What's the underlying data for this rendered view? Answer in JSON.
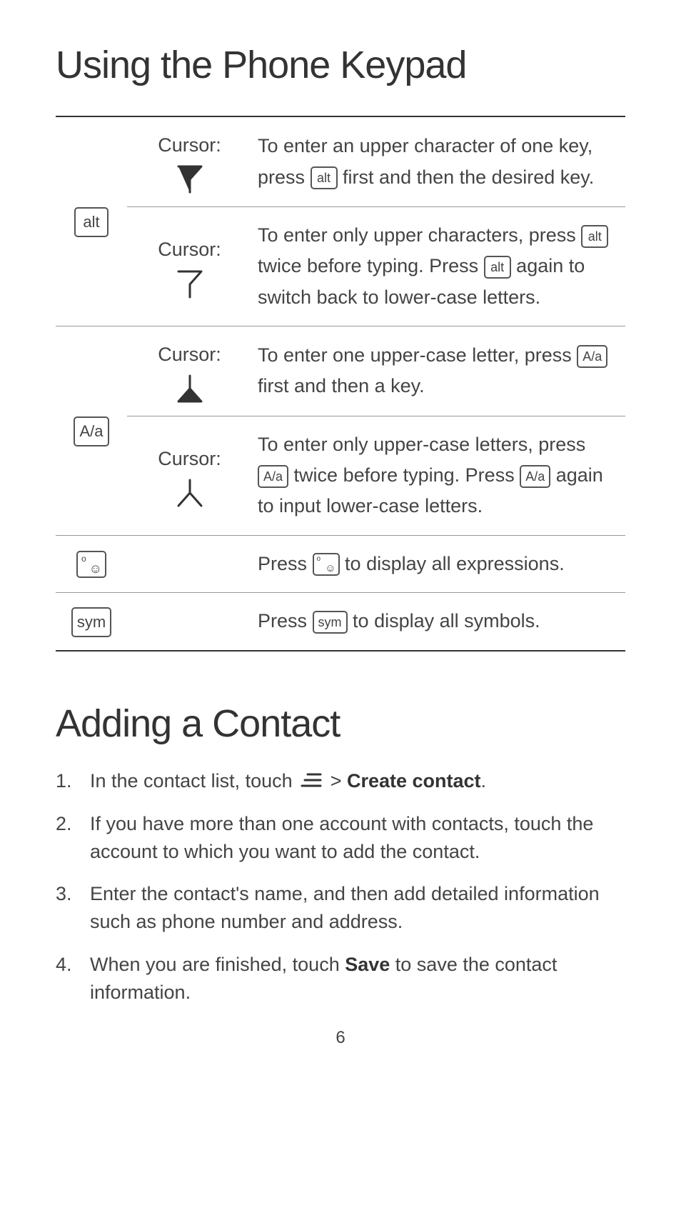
{
  "heading1": "Using the Phone Keypad",
  "heading2": "Adding a Contact",
  "keys": {
    "alt": "alt",
    "aa": "A/a",
    "sym": "sym",
    "emoji_sup": "o",
    "emoji_face": "☺"
  },
  "cursor_label": "Cursor:",
  "rows": {
    "alt_single": {
      "pre": "To enter an upper character of one key, press ",
      "post": " first and then the desired key."
    },
    "alt_double": {
      "pre": "To enter only upper characters, press ",
      "mid": " twice before typing. Press ",
      "post": " again to switch back to lower-case letters."
    },
    "aa_single": {
      "pre": "To enter one upper-case letter, press ",
      "post": " first and then a key."
    },
    "aa_double": {
      "pre": "To enter only upper-case letters, press ",
      "mid": " twice before typing. Press ",
      "post": " again to input lower-case letters."
    },
    "emoji": {
      "pre": "Press ",
      "post": " to display all expressions."
    },
    "sym": {
      "pre": "Press ",
      "post": " to display all symbols."
    }
  },
  "steps": {
    "s1_pre": "In the contact list, touch ",
    "s1_gt": " > ",
    "s1_bold": "Create contact",
    "s1_post": ".",
    "s2": "If you have more than one account with contacts, touch the account to which you want to add the contact.",
    "s3": "Enter the contact's name, and then add detailed information such as phone number and address.",
    "s4_pre": "When you are finished, touch ",
    "s4_bold": "Save",
    "s4_post": " to save the contact information."
  },
  "page_number": "6"
}
